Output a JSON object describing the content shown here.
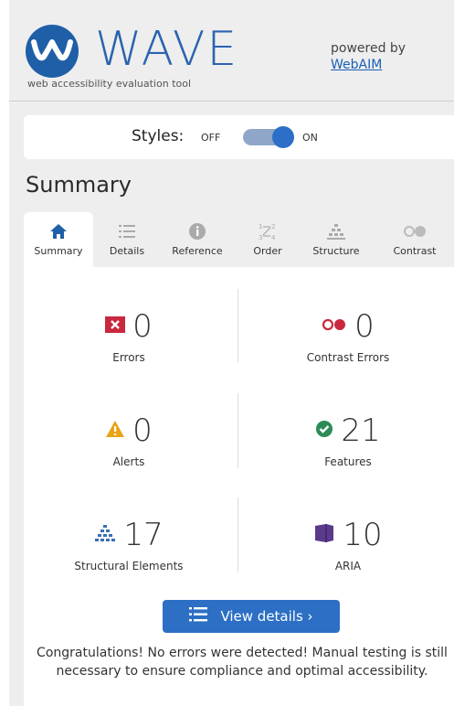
{
  "header": {
    "logo_text": "WAVE",
    "logo_subtitle": "web accessibility evaluation tool",
    "powered_by": "powered by",
    "webaim_link": "WebAIM"
  },
  "styles_toggle": {
    "label": "Styles:",
    "off": "OFF",
    "on": "ON",
    "state": "on"
  },
  "section_title": "Summary",
  "tabs": [
    {
      "label": "Summary",
      "icon": "home-icon",
      "active": true
    },
    {
      "label": "Details",
      "icon": "list-icon",
      "active": false
    },
    {
      "label": "Reference",
      "icon": "info-icon",
      "active": false
    },
    {
      "label": "Order",
      "icon": "order-icon",
      "active": false
    },
    {
      "label": "Structure",
      "icon": "structure-icon",
      "active": false
    },
    {
      "label": "Contrast",
      "icon": "contrast-icon",
      "active": false
    }
  ],
  "summary": {
    "errors": {
      "count": "0",
      "label": "Errors",
      "color": "#c9283e"
    },
    "contrast_errors": {
      "count": "0",
      "label": "Contrast Errors",
      "color": "#c9283e"
    },
    "alerts": {
      "count": "0",
      "label": "Alerts",
      "color": "#e8a317"
    },
    "features": {
      "count": "21",
      "label": "Features",
      "color": "#2e8b57"
    },
    "structural": {
      "count": "17",
      "label": "Structural Elements",
      "color": "#3a6fb5"
    },
    "aria": {
      "count": "10",
      "label": "ARIA",
      "color": "#5b3a8c"
    }
  },
  "view_details": "View details ›",
  "congrats": "Congratulations! No errors were detected! Manual testing is still necessary to ensure compliance and optimal accessibility."
}
